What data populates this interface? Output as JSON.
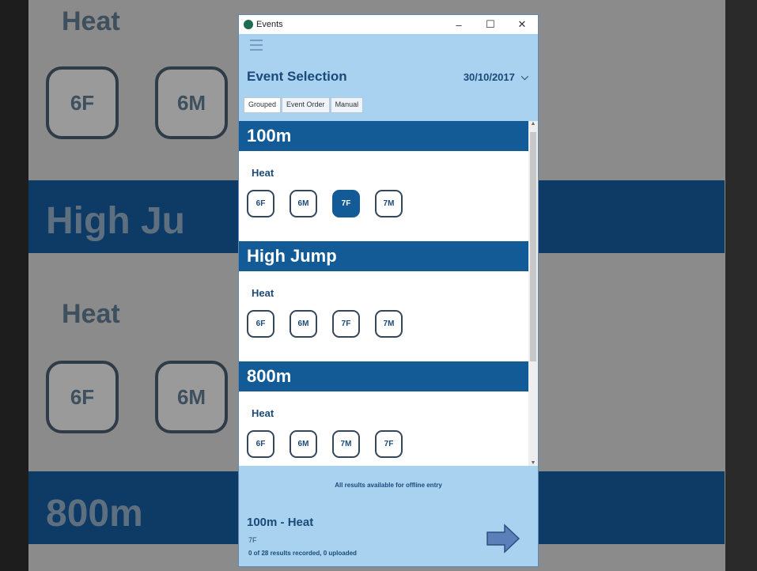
{
  "background": {
    "heat_top": "Heat",
    "btn_6f": "6F",
    "btn_6m": "6M",
    "high_jump": "High Ju",
    "heat_mid": "Heat",
    "btn_6f_2": "6F",
    "btn_6m_2": "6M",
    "event_800m": "800m"
  },
  "window": {
    "title": "Events",
    "minimize_glyph": "–",
    "maximize_glyph": "☐",
    "close_glyph": "✕"
  },
  "header": {
    "title": "Event Selection",
    "date": "30/10/2017",
    "date_chevron": "⌵"
  },
  "tabs": [
    {
      "label": "Grouped",
      "active": true
    },
    {
      "label": "Event Order",
      "active": false
    },
    {
      "label": "Manual",
      "active": false
    }
  ],
  "events": [
    {
      "name": "100m",
      "heat_label": "Heat",
      "buttons": [
        "6F",
        "6M",
        "7F",
        "7M"
      ],
      "selected_index": 2
    },
    {
      "name": "High Jump",
      "heat_label": "Heat",
      "buttons": [
        "6F",
        "6M",
        "7F",
        "7M"
      ],
      "selected_index": -1
    },
    {
      "name": "800m",
      "heat_label": "Heat",
      "buttons": [
        "6F",
        "6M",
        "7M",
        "7F"
      ],
      "selected_index": -1
    }
  ],
  "footer": {
    "offline_note": "All results available for offline entry",
    "summary_title": "100m - Heat",
    "summary_sub": "7F",
    "summary_status": "0 of 28 results recorded, 0 uploaded"
  },
  "colors": {
    "accent": "#135b96",
    "panel": "#a9d2f0",
    "text": "#1b4a78"
  },
  "icons": {
    "next": "right-arrow-icon",
    "menu": "hamburger-icon",
    "app": "app-logo-icon"
  }
}
